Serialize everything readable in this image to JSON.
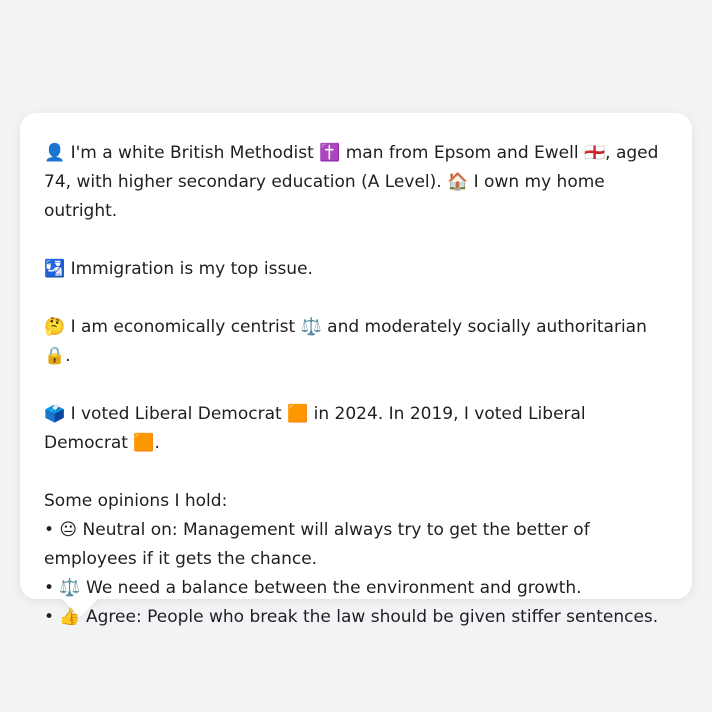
{
  "profile": {
    "intro": "👤 I'm a white British Methodist ✝️ man from Epsom and Ewell 🏴󠁧󠁢󠁥󠁮󠁧󠁿, aged 74, with higher secondary education (A Level). 🏠 I own my home outright.",
    "top_issue": "🛂 Immigration is my top issue.",
    "ideology": "🤔 I am economically centrist ⚖️ and moderately socially authoritarian 🔒.",
    "votes": "🗳️ I voted Liberal Democrat 🟧 in 2024. In 2019, I voted Liberal Democrat 🟧."
  },
  "opinions": {
    "heading": "Some opinions I hold:",
    "items": [
      "• 😐 Neutral on: Management will always try to get the better of employees if it gets the chance.",
      "• ⚖️ We need a balance between the environment and growth.",
      "• 👍 Agree: People who break the law should be given stiffer sentences."
    ]
  }
}
